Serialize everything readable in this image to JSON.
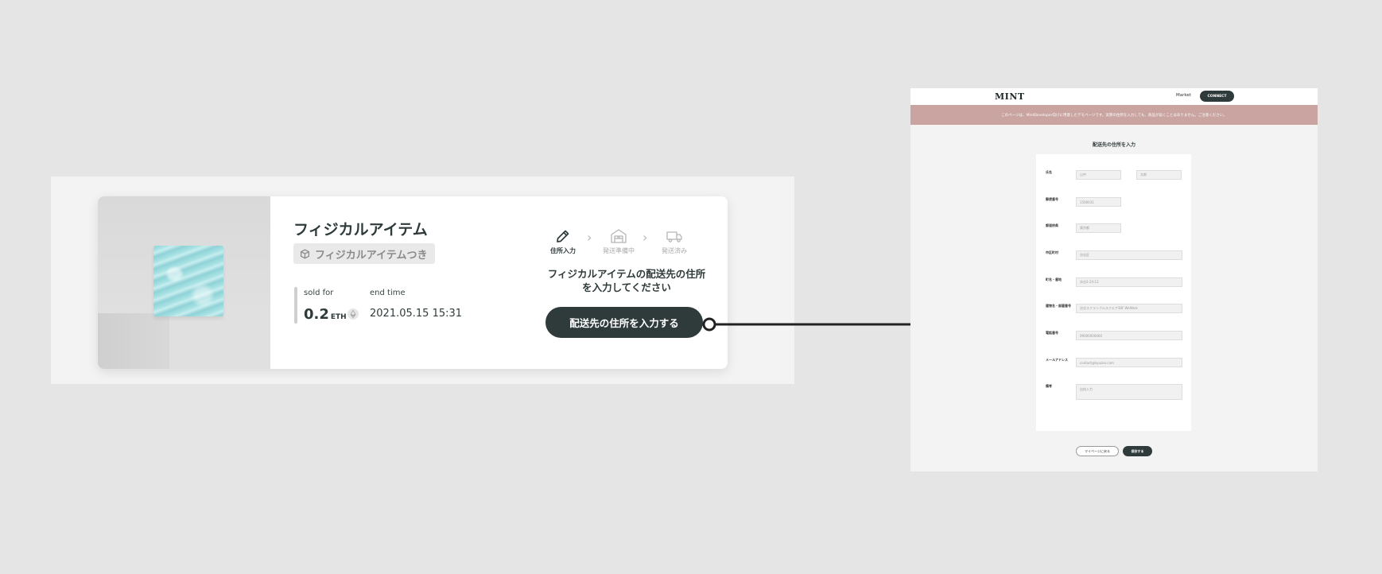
{
  "card": {
    "title": "フィジカルアイテム",
    "badge": "フィジカルアイテムつき",
    "sold_for_label": "sold for",
    "price_value": "0.2",
    "price_unit": "ETH",
    "end_time_label": "end time",
    "end_time_value": "2021.05.15 15:31",
    "steps": [
      {
        "label": "住所入力",
        "icon": "pencil-icon",
        "active": true
      },
      {
        "label": "発送準備中",
        "icon": "warehouse-icon",
        "active": false
      },
      {
        "label": "発送済み",
        "icon": "truck-icon",
        "active": false
      }
    ],
    "message_line1": "フィジカルアイテムの配送先の住所",
    "message_line2": "を入力してください",
    "cta_label": "配送先の住所を入力する"
  },
  "screenshot": {
    "logo": "MINT",
    "nav_market": "Market",
    "nav_connect": "CONNECT",
    "banner": "このページは、MintDeveloper向けに用意したデモページです。実際の住所を入力しても、商品が届くことはありません。ご注意ください。",
    "form_title": "配送先の住所を入力",
    "fields": [
      {
        "label": "氏名",
        "placeholder": "山中",
        "placeholder2": "太郎"
      },
      {
        "label": "郵便番号",
        "placeholder": "1500031"
      },
      {
        "label": "都道府県",
        "placeholder": "東京都"
      },
      {
        "label": "市区町村",
        "placeholder": "渋谷区"
      },
      {
        "label": "町名・番地",
        "placeholder": "渋谷2-24-12"
      },
      {
        "label": "建物名・部屋番号",
        "placeholder": "渋谷スクランブルスクエア38F WeWork"
      },
      {
        "label": "電話番号",
        "placeholder": "09000000000"
      },
      {
        "label": "メールアドレス",
        "placeholder": "contact@kyuzan.com"
      },
      {
        "label": "備考",
        "placeholder": "自由入力"
      }
    ],
    "back_button": "マイページに戻る",
    "save_button": "保存する"
  },
  "colors": {
    "primary_dark": "#2f3b3b",
    "banner": "#c9a4a0",
    "background": "#e5e5e5"
  }
}
